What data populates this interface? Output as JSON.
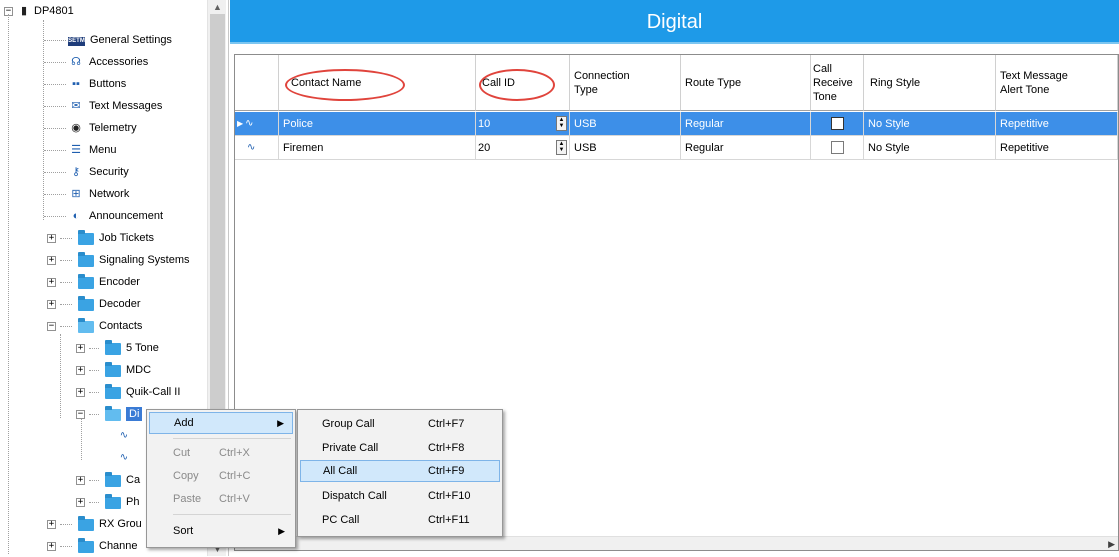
{
  "tree": {
    "root": "DP4801",
    "items": [
      {
        "label": "General Settings",
        "icon": "settings-icon"
      },
      {
        "label": "Accessories",
        "icon": "accessories-icon"
      },
      {
        "label": "Buttons",
        "icon": "buttons-icon"
      },
      {
        "label": "Text Messages",
        "icon": "envelope-icon"
      },
      {
        "label": "Telemetry",
        "icon": "telemetry-icon"
      },
      {
        "label": "Menu",
        "icon": "menu-icon"
      },
      {
        "label": "Security",
        "icon": "key-icon"
      },
      {
        "label": "Network",
        "icon": "network-icon"
      },
      {
        "label": "Announcement",
        "icon": "speaker-icon"
      },
      {
        "label": "Job Tickets",
        "icon": "folder-icon"
      },
      {
        "label": "Signaling Systems",
        "icon": "folder-icon"
      },
      {
        "label": "Encoder",
        "icon": "folder-icon"
      },
      {
        "label": "Decoder",
        "icon": "folder-icon"
      },
      {
        "label": "Contacts",
        "icon": "folder-open-icon"
      },
      {
        "label": "5 Tone",
        "icon": "folder-icon"
      },
      {
        "label": "MDC",
        "icon": "folder-icon"
      },
      {
        "label": "Quik-Call II",
        "icon": "folder-icon"
      },
      {
        "label": "Di",
        "icon": "folder-open-icon"
      },
      {
        "label": "Ca",
        "icon": "folder-icon"
      },
      {
        "label": "Ph",
        "icon": "folder-icon"
      },
      {
        "label": "RX Grou",
        "icon": "folder-icon"
      },
      {
        "label": "Channe",
        "icon": "folder-icon"
      }
    ]
  },
  "panel": {
    "title": "Digital"
  },
  "table": {
    "headers": [
      "Contact Name",
      "Call ID",
      "Connection Type",
      "Route Type",
      "Call Receive Tone",
      "Ring Style",
      "Text Message Alert Tone"
    ],
    "rows": [
      {
        "name": "Police",
        "call_id": "10",
        "connection": "USB",
        "route": "Regular",
        "receive_tone": false,
        "ring": "No Style",
        "alert": "Repetitive",
        "selected": true
      },
      {
        "name": "Firemen",
        "call_id": "20",
        "connection": "USB",
        "route": "Regular",
        "receive_tone": false,
        "ring": "No Style",
        "alert": "Repetitive",
        "selected": false
      }
    ]
  },
  "context_menu": {
    "items": [
      {
        "label": "Add",
        "shortcut": "",
        "disabled": false,
        "submenu": true
      },
      {
        "label": "Cut",
        "shortcut": "Ctrl+X",
        "disabled": true
      },
      {
        "label": "Copy",
        "shortcut": "Ctrl+C",
        "disabled": true
      },
      {
        "label": "Paste",
        "shortcut": "Ctrl+V",
        "disabled": true
      },
      {
        "label": "Sort",
        "shortcut": "",
        "disabled": false,
        "submenu": true
      }
    ]
  },
  "submenu": {
    "items": [
      {
        "label": "Group Call",
        "shortcut": "Ctrl+F7"
      },
      {
        "label": "Private Call",
        "shortcut": "Ctrl+F8"
      },
      {
        "label": "All Call",
        "shortcut": "Ctrl+F9"
      },
      {
        "label": "Dispatch Call",
        "shortcut": "Ctrl+F10"
      },
      {
        "label": "PC Call",
        "shortcut": "Ctrl+F11"
      }
    ]
  },
  "colors": {
    "title_bar": "#1e9ae8",
    "selected_row": "#3d8fe8",
    "highlight_circle": "#e0443c"
  }
}
